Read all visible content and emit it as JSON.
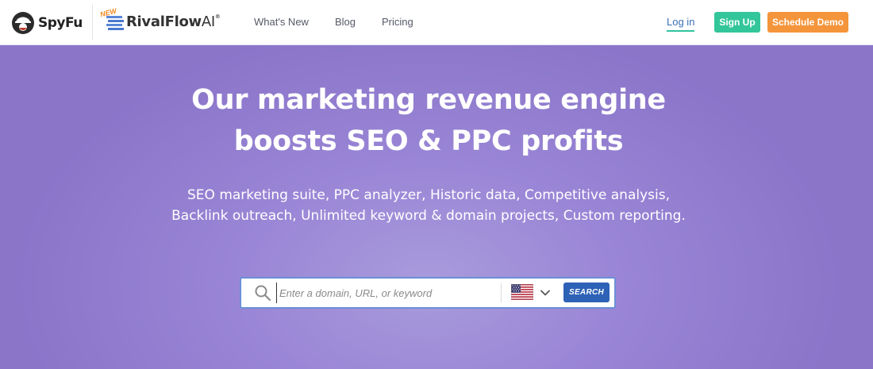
{
  "brand": {
    "spyfu_name": "SpyFu",
    "rival_new_badge": "NEW",
    "rival_name": "RivalFlow",
    "rival_ai": "AI",
    "rival_tm": "®"
  },
  "nav": {
    "links": [
      "What's New",
      "Blog",
      "Pricing"
    ],
    "login": "Log in",
    "signup": "Sign Up",
    "schedule_demo": "Schedule Demo"
  },
  "hero": {
    "title_line1": "Our marketing revenue engine",
    "title_line2": "boosts SEO & PPC profits",
    "subtitle": "SEO marketing suite, PPC analyzer, Historic data, Competitive analysis, Backlink outreach, Unlimited keyword & domain projects, Custom reporting."
  },
  "search": {
    "placeholder": "Enter a domain, URL, or keyword",
    "country_icon": "us-flag-icon",
    "button": "SEARCH"
  },
  "colors": {
    "signup_bg": "#33c69a",
    "demo_bg": "#f5953b",
    "search_btn_bg": "#2e62b7",
    "hero_bg": "#8a75c9",
    "login_underline": "#2fc49d"
  }
}
